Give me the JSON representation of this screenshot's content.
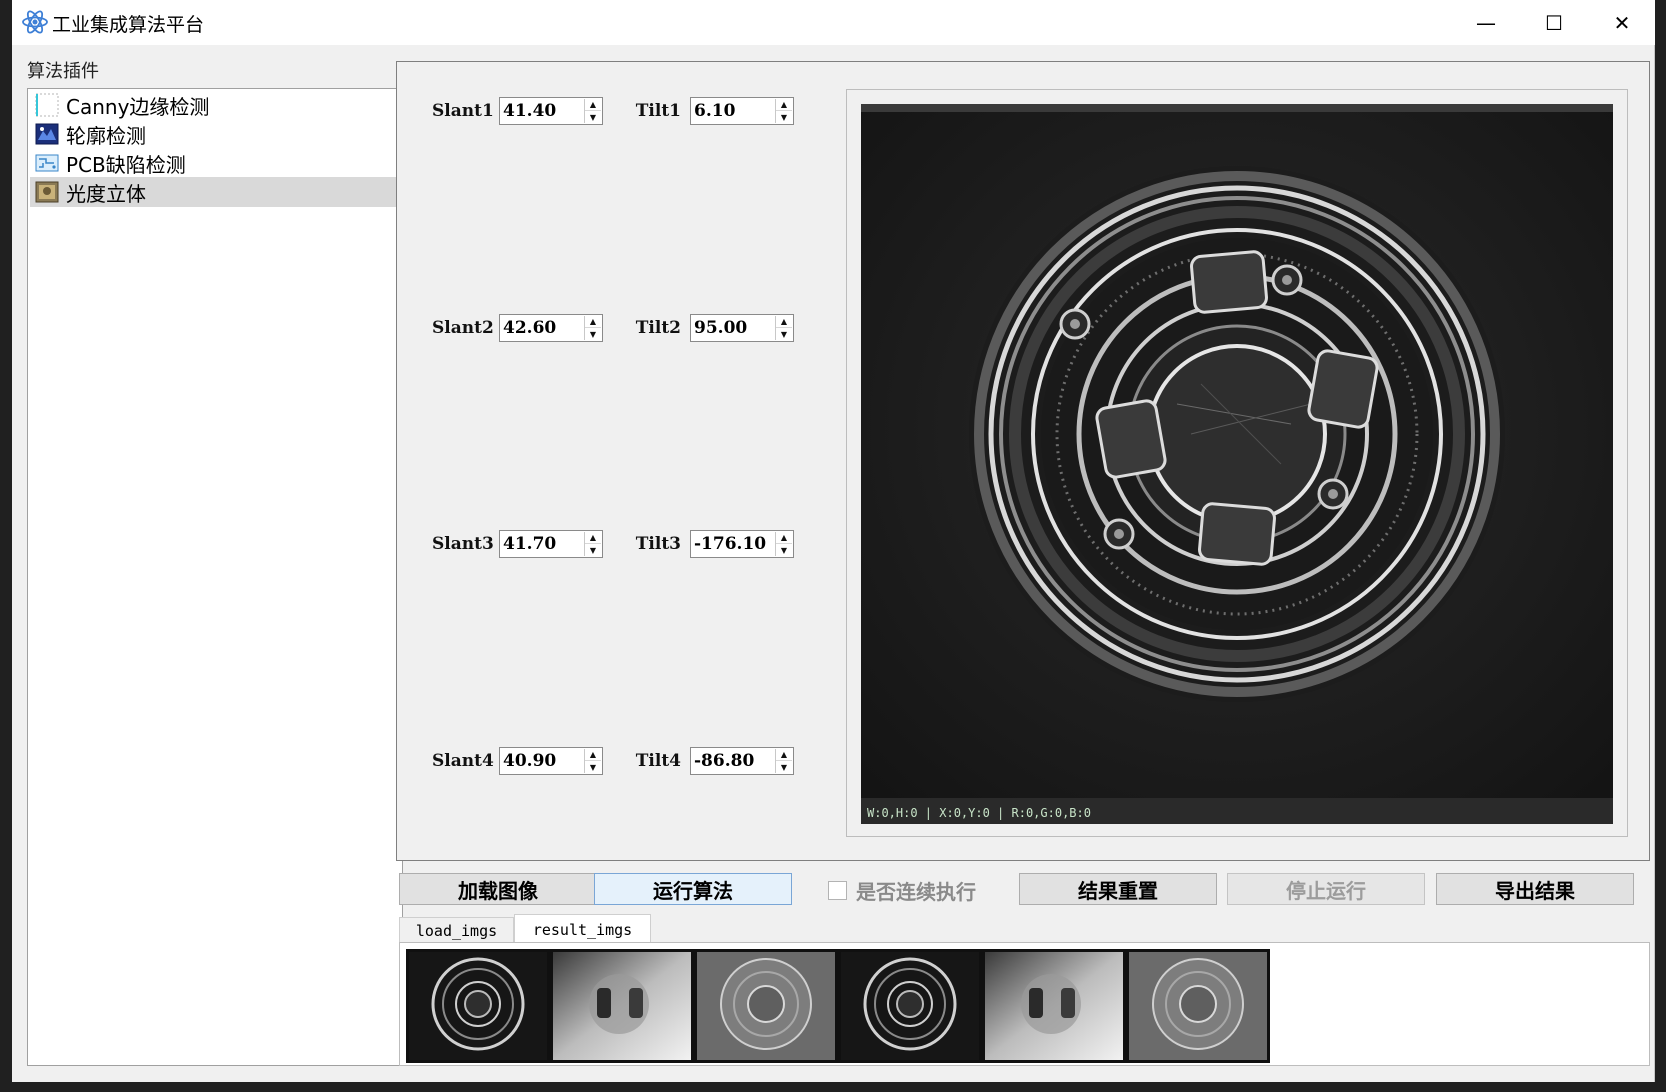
{
  "window": {
    "title": "工业集成算法平台",
    "controls": {
      "minimize": "—",
      "maximize": "☐",
      "close": "✕"
    }
  },
  "sidebar": {
    "label": "算法插件",
    "items": [
      {
        "label": "Canny边缘检测",
        "icon": "canny-icon",
        "selected": false
      },
      {
        "label": "轮廓检测",
        "icon": "contour-icon",
        "selected": false
      },
      {
        "label": "PCB缺陷检测",
        "icon": "pcb-icon",
        "selected": false
      },
      {
        "label": "光度立体",
        "icon": "photometric-icon",
        "selected": true
      }
    ]
  },
  "params": [
    {
      "slant_label": "Slant1",
      "slant_value": "41.40",
      "tilt_label": "Tilt1",
      "tilt_value": "6.10"
    },
    {
      "slant_label": "Slant2",
      "slant_value": "42.60",
      "tilt_label": "Tilt2",
      "tilt_value": "95.00"
    },
    {
      "slant_label": "Slant3",
      "slant_value": "41.70",
      "tilt_label": "Tilt3",
      "tilt_value": "-176.10"
    },
    {
      "slant_label": "Slant4",
      "slant_value": "40.90",
      "tilt_label": "Tilt4",
      "tilt_value": "-86.80"
    }
  ],
  "viewer": {
    "status": "W:0,H:0 | X:0,Y:0 | R:0,G:0,B:0"
  },
  "actions": {
    "load": "加载图像",
    "run": "运行算法",
    "continuous": "是否连续执行",
    "continuous_checked": false,
    "reset": "结果重置",
    "stop": "停止运行",
    "export": "导出结果"
  },
  "tabs": {
    "load": "load_imgs",
    "result": "result_imgs",
    "active": "result_imgs"
  },
  "thumbnails": [
    {
      "name": "thumb-1",
      "style": "coin"
    },
    {
      "name": "thumb-2",
      "style": "shading"
    },
    {
      "name": "thumb-3",
      "style": "relief"
    },
    {
      "name": "thumb-4",
      "style": "coin"
    },
    {
      "name": "thumb-5",
      "style": "shading"
    },
    {
      "name": "thumb-6",
      "style": "relief"
    }
  ],
  "colors": {
    "window_bg": "#f0f0f0",
    "primary_button": "#e5f1fb",
    "selected_item": "#d9d9d9"
  }
}
